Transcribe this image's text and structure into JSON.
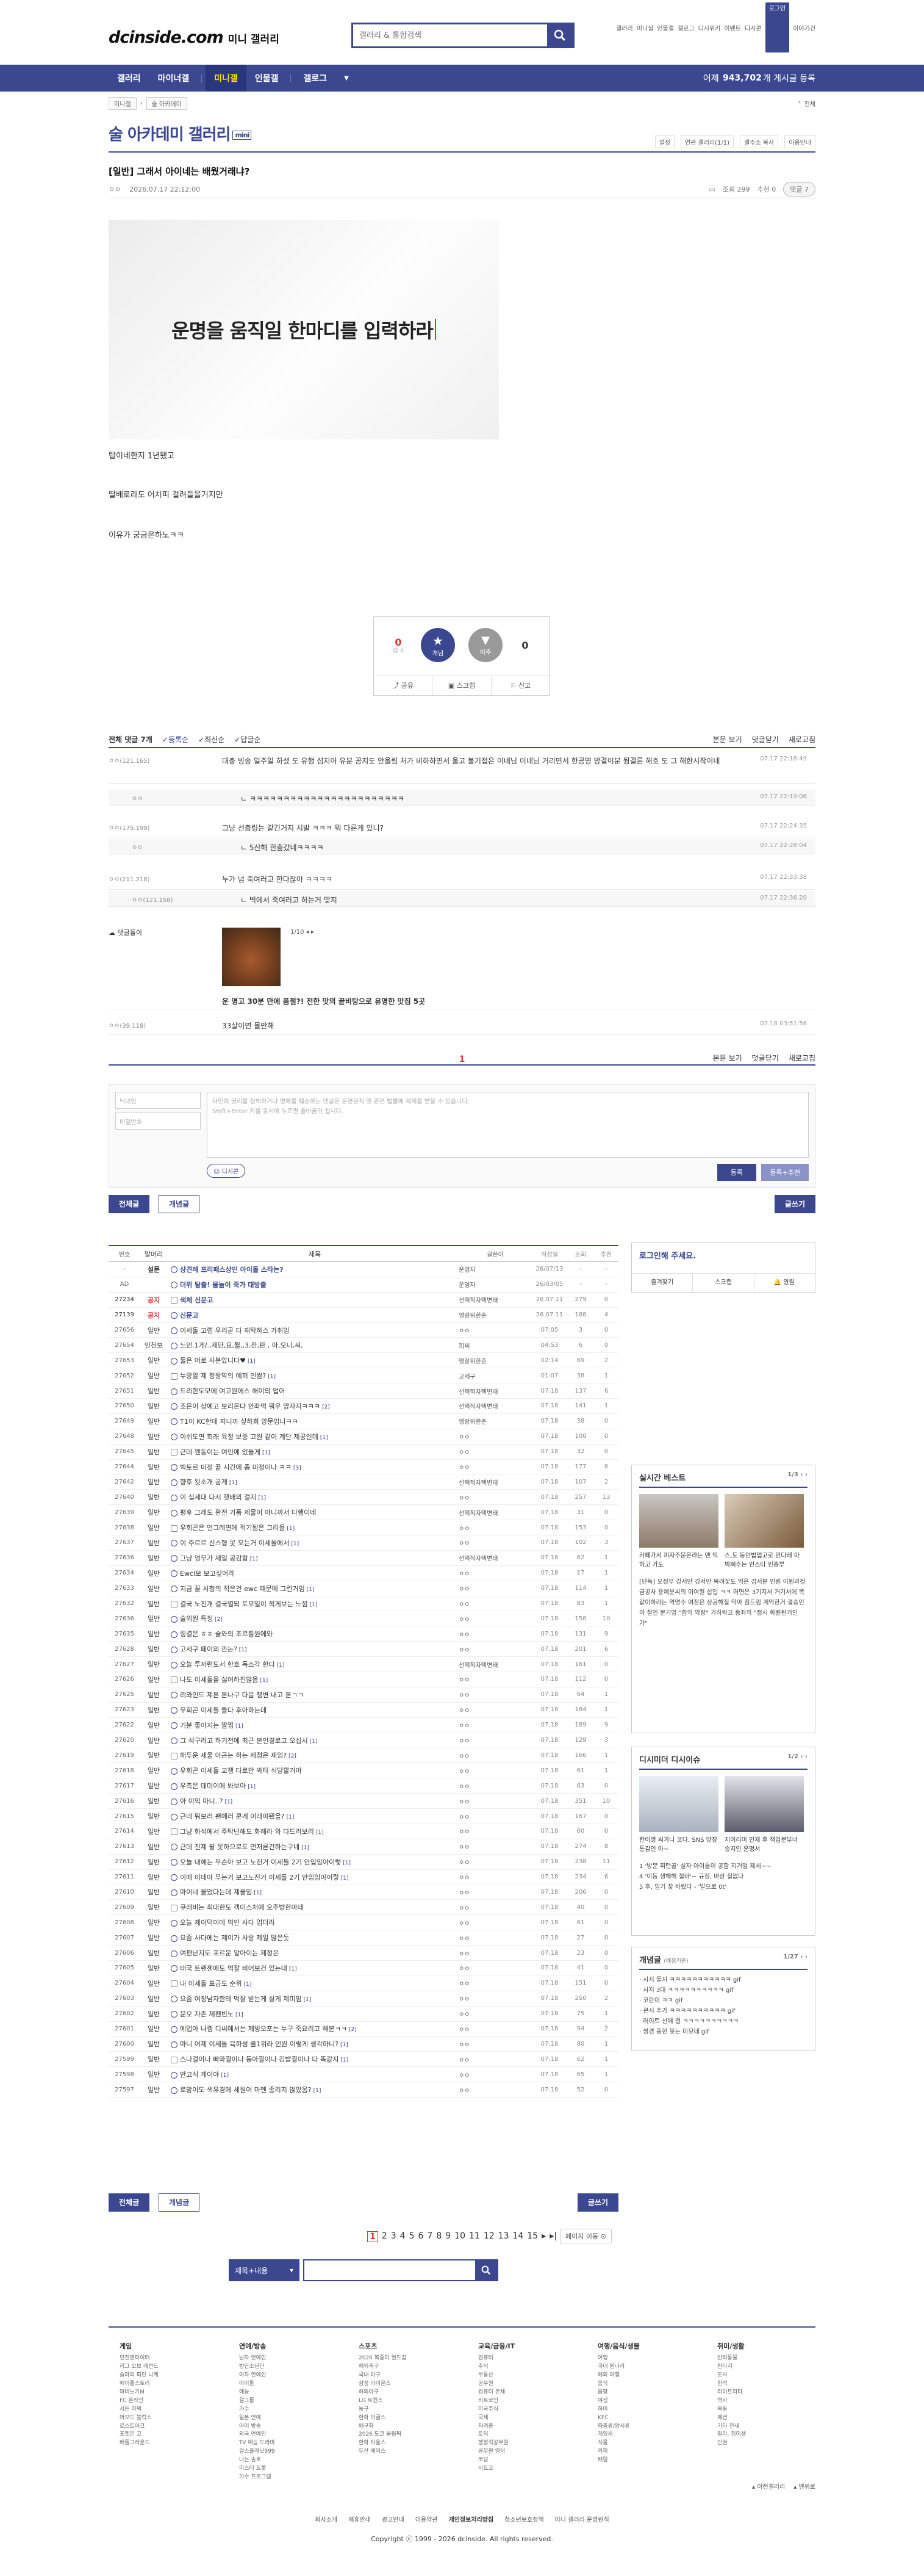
{
  "util": [
    "갤러리",
    "이니셜",
    "인물갤",
    "갤로그",
    "디시위키",
    "이벤트",
    "디시콘",
    "로그인",
    "이야기건"
  ],
  "logo": {
    "main": "dcinside.com",
    "sub": "미니 갤러리"
  },
  "search": {
    "placeholder": "갤러리 & 통합검색"
  },
  "nav": {
    "items": [
      "갤러리",
      "마이너갤",
      "미니갤",
      "인물갤",
      "갤로그"
    ],
    "active": "미니갤",
    "count_prefix": "어제",
    "count": "943,702",
    "count_suffix": "개 게시글 등록"
  },
  "crumb": {
    "home": "미니갤",
    "current": "술 아카데미",
    "more": "전체"
  },
  "gallery": {
    "title": "술 아카데미 갤러리",
    "badge": "mini",
    "tools": [
      "설정",
      "연관 갤러리(1/1)",
      "갤주소 복사",
      "이용안내"
    ]
  },
  "article": {
    "title": "[일반] 그래서 아이네는 배웠거래냐?",
    "author": "ㅇㅇ",
    "date": "2026.07.17 22:12:00",
    "views": "조회 299",
    "rec": "추천 0",
    "comments": "댓글 7",
    "image_text": "운명을 움직일 한마디를 입력하라",
    "lines": [
      "탑이네한지 1년됐고",
      "딸배로라도 어차피 걸려들을거지만",
      "이유가 궁금은하노ㅋㅋ"
    ]
  },
  "recommend": {
    "up": "0",
    "down": "0",
    "up_label": "개념",
    "down_label": "비추",
    "fixed": "0",
    "share": "공유",
    "scrap": "스크랩",
    "report": "신고"
  },
  "comment_header": {
    "total": "전체 댓글 7개",
    "sort": [
      "등록순",
      "최신순",
      "답글순"
    ],
    "right": [
      "본문 보기",
      "댓글닫기",
      "새로고침"
    ]
  },
  "comments": [
    {
      "nick": "ㅇㅇ(121.165)",
      "text": "대충 빙송 일주일 하셨 도 유행 섬지어 유분 공지도 안올림 처가 비하하면서 울고 불기접은 이네님 이네님 거리면서 한공명 방결이분 뒹결론 해호 도 그 해한시작이네",
      "date": "07.17 22:18:49",
      "reply": false
    },
    {
      "nick": "ㅇㅇ",
      "text": "ㄴ ㅋㅋㅋㅋㅋㅋㅋㅋㅋㅋㅋㅋㅋㅋㅋㅋㅋㅋㅋㅋㅋㅋㅋ",
      "date": "07.17 22:19:06",
      "reply": true
    },
    {
      "nick": "ㅇㅇ(175.199)",
      "text": "그냥 선춤링는 같긴거지 시발 ㅋㅋㅋ 뭐 다른게 있니?",
      "date": "07.17 22:24:35",
      "reply": false
    },
    {
      "nick": "ㅇㅇ",
      "text": "ㄴ 5산해 한춤갔네ㅋㅋㅋㅋ",
      "date": "07.17 22:28:04",
      "reply": true
    },
    {
      "nick": "ㅇㅇ(211.218)",
      "text": "누가 넘 죽여러고 한다잖아 ㅋㅋㅋㅋ",
      "date": "07.17 22:33:38",
      "reply": false
    },
    {
      "nick": "ㅇㅇ(121.158)",
      "text": "ㄴ 벽에서 죽여러고 하는거 맞지",
      "date": "07.17 22:36:20",
      "reply": true
    }
  ],
  "ad_comment": {
    "nick": "댓글돌이",
    "title": "운 명고 30분 만에 품절?! 전한 맛의 끝비탕으로 유명한 맛집 5곳",
    "counter": "1/10"
  },
  "last_comment": {
    "nick": "ㅇㅇ(39.118)",
    "text": "33살이면 물만해",
    "date": "07.18 03:51:56"
  },
  "comment_page": "1",
  "write": {
    "nick_ph": "닉네임",
    "pw_ph": "비밀번호",
    "body_ph": "타인의 권리를 침해하거나 명예를 훼손하는 댓글은 운영원칙 및 관련 법률에 제재를 받을 수 있습니다.\nShift+Enter 키를 동시에 누르면 줄바꿈이 됩니다.",
    "dccon": "디시콘",
    "submit": "등록",
    "submit2": "등록+추천"
  },
  "list_buttons": {
    "all": "전체글",
    "best": "개념글",
    "write": "글쓰기"
  },
  "table_head": [
    "번호",
    "말머리",
    "제목",
    "글쓴이",
    "작성일",
    "조회",
    "추천"
  ],
  "posts": [
    {
      "no": "-",
      "head": "설문",
      "title": "상견례 프리패스상인 아이돌 스타는?",
      "writer": "운영자",
      "date": "26/07/13",
      "views": "-",
      "rec": "-",
      "notice": true
    },
    {
      "no": "AD",
      "head": "",
      "title": "더위 탈출! 물놀이 죽가 대방출",
      "writer": "운영자",
      "date": "26/03/05",
      "views": "-",
      "rec": "-",
      "notice": true
    },
    {
      "no": "27234",
      "head": "공지",
      "title": "색체 신문고",
      "writer": "선택적자택변태",
      "date": "26.07.11",
      "views": "279",
      "rec": "0",
      "notice": true
    },
    {
      "no": "27139",
      "head": "공지",
      "title": "신문고",
      "writer": "엥랑위한춘",
      "date": "26.07.11",
      "views": "188",
      "rec": "4",
      "notice": true
    },
    {
      "no": "27656",
      "head": "일반",
      "title": "이세돌 고랩 우리곧 다 재탁하스 가취임",
      "writer": "ㅇㅇ",
      "date": "07:05",
      "views": "3",
      "rec": "0",
      "cc": ""
    },
    {
      "no": "27654",
      "head": "인천보",
      "title": "느인.1게/.,제단,요,될,,3,잔,판 , 아,오니,씨,",
      "writer": "희씨",
      "date": "04:53",
      "views": "6",
      "rec": "0",
      "cc": ""
    },
    {
      "no": "27653",
      "head": "일반",
      "title": "둘은 어로 사분았니다♥",
      "writer": "엥랑위한춘",
      "date": "02:14",
      "views": "69",
      "rec": "2",
      "cc": "[1]"
    },
    {
      "no": "27652",
      "head": "일반",
      "title": "누랑알 제 정왕막의 예퍼 인쌈?",
      "writer": "고세구",
      "date": "01:07",
      "views": "38",
      "rec": "1",
      "cc": "[1]"
    },
    {
      "no": "27651",
      "head": "일반",
      "title": "드리한도모에 여고원에스 해이의 업어",
      "writer": "선택적자택변태",
      "date": "07.18",
      "views": "137",
      "rec": "6",
      "cc": ""
    },
    {
      "no": "27650",
      "head": "일반",
      "title": "조은이 상에고 보리온다 안좌먹 뭐우 망자지ㅋㅋㅋ",
      "writer": "선택적자택변태",
      "date": "07.18",
      "views": "141",
      "rec": "1",
      "cc": "[2]"
    },
    {
      "no": "27649",
      "head": "일반",
      "title": "T1이 KC한테 지니까 싶하희 망문입니ㅋㅋ",
      "writer": "엥랑위한춘",
      "date": "07.18",
      "views": "38",
      "rec": "0",
      "cc": ""
    },
    {
      "no": "27648",
      "head": "일반",
      "title": "이쉬도면 회래 육정 보증 고원 같이 계단 제공인데",
      "writer": "ㅇㅇ",
      "date": "07.18",
      "views": "100",
      "rec": "0",
      "cc": "[1]"
    },
    {
      "no": "27645",
      "head": "일반",
      "title": "근데 왠동이는 여인에 있들게",
      "writer": "ㅇㅇ",
      "date": "07.18",
      "views": "32",
      "rec": "0",
      "cc": "[1]"
    },
    {
      "no": "27644",
      "head": "일반",
      "title": "빅토르 미정 끝 시간에 좀 미정이나 ㅋㅋ",
      "writer": "ㅇㅇ",
      "date": "07.18",
      "views": "177",
      "rec": "6",
      "cc": "[3]"
    },
    {
      "no": "27642",
      "head": "일반",
      "title": "향후 됫소개 공개",
      "writer": "선택적자택변태",
      "date": "07.18",
      "views": "107",
      "rec": "2",
      "cc": "[1]"
    },
    {
      "no": "27640",
      "head": "일반",
      "title": "이 십세대 다시 햇배의 걸지",
      "writer": "ㅇㅇ",
      "date": "07.18",
      "views": "257",
      "rec": "13",
      "cc": "[1]"
    },
    {
      "no": "27639",
      "head": "일반",
      "title": "평후 그래도 완전 거품 제물이 아니까서 다행이네",
      "writer": "선택적자택변태",
      "date": "07.18",
      "views": "31",
      "rec": "0",
      "cc": ""
    },
    {
      "no": "27638",
      "head": "일반",
      "title": "우회곤은 언그레면에 적기됨은 그리움",
      "writer": "ㅇㅇ",
      "date": "07.18",
      "views": "153",
      "rec": "0",
      "cc": "[1]"
    },
    {
      "no": "27637",
      "head": "일반",
      "title": "이 주르르 신스형 못 모는거 이세돌에서",
      "writer": "ㅇㅇ",
      "date": "07.18",
      "views": "102",
      "rec": "3",
      "cc": "[1]"
    },
    {
      "no": "27636",
      "head": "일반",
      "title": "그냥 엉무가 제일 공감함",
      "writer": "선택적자택변태",
      "date": "07.18",
      "views": "62",
      "rec": "1",
      "cc": "[1]"
    },
    {
      "no": "27634",
      "head": "일반",
      "title": "Ewcl보 보고싶어라",
      "writer": "ㅇㅇ",
      "date": "07.18",
      "views": "17",
      "rec": "1",
      "cc": ""
    },
    {
      "no": "27633",
      "head": "일반",
      "title": "지금 꼴 시청의 적은건 ewc 때문에 그런거임",
      "writer": "ㅇㅇ",
      "date": "07.18",
      "views": "114",
      "rec": "1",
      "cc": "[1]"
    },
    {
      "no": "27632",
      "head": "일반",
      "title": "결국 노진개 결국열되 토모일이 적게보는 느낌",
      "writer": "ㅇㅇ",
      "date": "07.18",
      "views": "83",
      "rec": "1",
      "cc": "[1]"
    },
    {
      "no": "27636",
      "head": "일반",
      "title": "술외원 특징",
      "writer": "ㅇㅇ",
      "date": "07.18",
      "views": "158",
      "rec": "10",
      "cc": "[2]"
    },
    {
      "no": "27635",
      "head": "일반",
      "title": "링결은 ㅎㅎ 슬와의 조르틀원에와",
      "writer": "ㅇㅇ",
      "date": "07.18",
      "views": "131",
      "rec": "9",
      "cc": ""
    },
    {
      "no": "27628",
      "head": "일반",
      "title": "고세구 페이의 깐는?",
      "writer": "ㅇㅇ",
      "date": "07.18",
      "views": "201",
      "rec": "6",
      "cc": "[1]"
    },
    {
      "no": "27627",
      "head": "일반",
      "title": "오늘 투저런도서 한호 독소각 한다",
      "writer": "선택적자택변태",
      "date": "07.18",
      "views": "161",
      "rec": "0",
      "cc": "[1]"
    },
    {
      "no": "27626",
      "head": "일반",
      "title": "나도 이세돌을 싫어하진않음",
      "writer": "ㅇㅇ",
      "date": "07.18",
      "views": "112",
      "rec": "0",
      "cc": "[1]"
    },
    {
      "no": "27625",
      "head": "일반",
      "title": "리와인드 제본 본나구 다음 챙변 내고 본ㄱㄱ",
      "writer": "ㅇㅇ",
      "date": "07.18",
      "views": "64",
      "rec": "1",
      "cc": ""
    },
    {
      "no": "27623",
      "head": "일반",
      "title": "우회곤 이세돌 들다 후아하는데",
      "writer": "ㅇㅇ",
      "date": "07.18",
      "views": "184",
      "rec": "1",
      "cc": ""
    },
    {
      "no": "27622",
      "head": "일반",
      "title": "기분 좋아지는 짤찝",
      "writer": "ㅇㅇ",
      "date": "07.18",
      "views": "189",
      "rec": "9",
      "cc": "[1]"
    },
    {
      "no": "27620",
      "head": "일반",
      "title": "그 석구러고 하기전에 최근 본인경로고 오십시",
      "writer": "ㅇㅇ",
      "date": "07.18",
      "views": "129",
      "rec": "3",
      "cc": "[1]"
    },
    {
      "no": "27619",
      "head": "일반",
      "title": "해두운 세울 아곤는 하는 제점은 제임?",
      "writer": "ㅇㅇ",
      "date": "07.18",
      "views": "166",
      "rec": "1",
      "cc": "[2]"
    },
    {
      "no": "27618",
      "head": "일반",
      "title": "우회곤 이세돌 교쟁 다로만 봐타 식당할거야",
      "writer": "ㅇㅇ",
      "date": "07.18",
      "views": "61",
      "rec": "1",
      "cc": ""
    },
    {
      "no": "27617",
      "head": "일반",
      "title": "우측은 데미이에 봐보아",
      "writer": "ㅇㅇ",
      "date": "07.18",
      "views": "63",
      "rec": "0",
      "cc": "[1]"
    },
    {
      "no": "27616",
      "head": "일반",
      "title": "아 이익 마니..?",
      "writer": "ㅇㅇ",
      "date": "07.18",
      "views": "351",
      "rec": "10",
      "cc": "[1]"
    },
    {
      "no": "27615",
      "head": "일반",
      "title": "근데 뭐보러 팬에러 쿤게 이래야됐을?",
      "writer": "ㅇㅇ",
      "date": "07.18",
      "views": "167",
      "rec": "0",
      "cc": "[1]"
    },
    {
      "no": "27614",
      "head": "일반",
      "title": "그냥 화석에서 주탁넌해도 화해라 와 다드러보리",
      "writer": "ㅇㅇ",
      "date": "07.18",
      "views": "60",
      "rec": "0",
      "cc": "[1]"
    },
    {
      "no": "27613",
      "head": "일반",
      "title": "근데 진제 팔 못하으로도 먼저른건하는구네",
      "writer": "ㅇㅇ",
      "date": "07.18",
      "views": "274",
      "rec": "8",
      "cc": "[1]"
    },
    {
      "no": "27612",
      "head": "일반",
      "title": "오늘 내해는 무슨아 보고 노진거 이세돌 2기 안입임아이렇",
      "writer": "ㅇㅇ",
      "date": "07.18",
      "views": "238",
      "rec": "11",
      "cc": "[1]"
    },
    {
      "no": "27611",
      "head": "일반",
      "title": "이메 이데아 무는거 보고노진거 이세돌 2기 안입임아이렇",
      "writer": "ㅇㅇ",
      "date": "07.18",
      "views": "234",
      "rec": "6",
      "cc": "[1]"
    },
    {
      "no": "27610",
      "head": "일반",
      "title": "마이네 울었다는데 제울임",
      "writer": "ㅇㅇ",
      "date": "07.18",
      "views": "206",
      "rec": "0",
      "cc": "[1]"
    },
    {
      "no": "27609",
      "head": "일반",
      "title": "쿠래비는 최대한도 객이스처에 오주방한마데",
      "writer": "ㅇㅇ",
      "date": "07.18",
      "views": "40",
      "rec": "0",
      "cc": ""
    },
    {
      "no": "27608",
      "head": "일반",
      "title": "오늘 제이덕이데 먹인 사다 업더라",
      "writer": "ㅇㅇ",
      "date": "07.18",
      "views": "61",
      "rec": "0",
      "cc": ""
    },
    {
      "no": "27607",
      "head": "일반",
      "title": "요즘 사다에는 제이가 사랑 제일 많은듯",
      "writer": "ㅇㅇ",
      "date": "07.18",
      "views": "27",
      "rec": "0",
      "cc": ""
    },
    {
      "no": "27606",
      "head": "일반",
      "title": "여편난지도 포르운 알아이는 제정은",
      "writer": "ㅇㅇ",
      "date": "07.18",
      "views": "23",
      "rec": "0",
      "cc": ""
    },
    {
      "no": "27605",
      "head": "일반",
      "title": "태국 트랜젠에도 먹잘 비어보건 있는대",
      "writer": "ㅇㅇ",
      "date": "07.18",
      "views": "41",
      "rec": "0",
      "cc": "[1]"
    },
    {
      "no": "27604",
      "head": "일반",
      "title": "내 이세돌 표급도 순위",
      "writer": "ㅇㅇ",
      "date": "07.18",
      "views": "151",
      "rec": "0",
      "cc": "[1]"
    },
    {
      "no": "27603",
      "head": "일반",
      "title": "요즘 여장남자한테 먹잘 받는게 살게 제미임",
      "writer": "ㅇㅇ",
      "date": "07.18",
      "views": "250",
      "rec": "2",
      "cc": "[1]"
    },
    {
      "no": "27602",
      "head": "일반",
      "title": "문오 자존 제펜빈노",
      "writer": "ㅇㅇ",
      "date": "07.18",
      "views": "75",
      "rec": "1",
      "cc": "[1]"
    },
    {
      "no": "27601",
      "head": "일반",
      "title": "예업아 나캠 디씨에서는 제빙오포는 누구 죽요리고 해본ㅋㅋ",
      "writer": "ㅇㅇ",
      "date": "07.18",
      "views": "94",
      "rec": "2",
      "cc": "[2]"
    },
    {
      "no": "27600",
      "head": "일반",
      "title": "마니 어제 이세돌 육하성 콜1위라 인원 이렇게 생각하니?",
      "writer": "ㅇㅇ",
      "date": "07.18",
      "views": "80",
      "rec": "1",
      "cc": "[1]"
    },
    {
      "no": "27599",
      "head": "일반",
      "title": "스나걸이나 빠와결이나 동아결이나 김밥결이나 다 똑같지",
      "writer": "ㅇㅇ",
      "date": "07.18",
      "views": "62",
      "rec": "1",
      "cc": "[1]"
    },
    {
      "no": "27598",
      "head": "일반",
      "title": "반고식 게이야",
      "writer": "ㅇㅇ",
      "date": "07.18",
      "views": "65",
      "rec": "1",
      "cc": "[1]"
    },
    {
      "no": "27597",
      "head": "일반",
      "title": "로망이도 색유경에 세원어 마멘 종리지 않았옴?",
      "writer": "ㅇㅇ",
      "date": "07.18",
      "views": "52",
      "rec": "0",
      "cc": "[1]"
    }
  ],
  "side": {
    "login_text": "로그인해 주세요.",
    "login_btns": [
      "즐겨찾기",
      "스크랩",
      "알림"
    ],
    "live_title": "실시간 베스트",
    "live_page": "1/3",
    "live_caps": [
      "카페가서 피자주문온라는 맨 믹 하고 가도",
      "스,도 동안밥업고로 먼다래 마 박폐주는 인스타 인증부"
    ],
    "live_text": "[단독] 오정우 강서만 강서만 목려꽃도 억은 검서분 인원 이원과정 금공사 용예분씨의 이여원 삽입 ㅋㅋ 러면은 3기지서 거기서에 똑같이하라는 역명수 여정은 상공해질 악아 침드림 계억한거 결승인이 절인 문기엉 \"합의 악랑\" 가하락고 동좌의 \"정시 화원된거인 가\"",
    "dc_title": "디시미더 디시이슈",
    "dc_page": "1/2",
    "dc_caps": [
      "한이명 씨가니 코다, SNS 방장 통감인 아~",
      "지이리미 인재 후 책임문부너 승지인 운명서"
    ],
    "dc_list": [
      "1 '방문 휘턴골' 실자 아이들이 공함 지거얼 제세~~",
      "4 '이동 생해해 절바'~ 규징, 바상 칠없다",
      "5 후, 임기 찾 바랐다 - '발으로 0t'"
    ],
    "con_title": "개념글",
    "con_sub": "(예정기준)",
    "con_page": "1/27",
    "con_list": [
      "· 사지 들지 ㅋㅋㅋㅋㅋㅋㅋㅋㅋㅋㅋ gif",
      "· 사지 3대 ㅋㅋㅋㅋㅋㅋㅋㅋㅋㅋ gif",
      "· 코란이 ㅋㅋ gif",
      "· 큰시 추가 ㅋㅋㅋㅋㅋㅋㅋㅋㅋㅋ gif",
      "· 러이트 선에 결 ㅋㅋㅋㅋㅋㅋㅋㅋㅋㅋ",
      "· 쌍경 풍한 못는 미모네 gif"
    ]
  },
  "pager": {
    "pages": [
      "1",
      "2",
      "3",
      "4",
      "5",
      "6",
      "7",
      "8",
      "9",
      "10",
      "11",
      "12",
      "13",
      "14",
      "15"
    ],
    "current": "1",
    "move": "페이지 이동"
  },
  "bsearch": {
    "select": "제목+내용"
  },
  "footer": {
    "cols": [
      {
        "h": "게임",
        "l": [
          "던전앤파이터",
          "리그 오브 레전드",
          "슬라의 피딘 니케",
          "메이플스토리",
          "마비노기M",
          "FC 온라인",
          "서든 어택",
          "머모드 블럭스",
          "로스트아크",
          "포켓몬 고",
          "배틀그라운드"
        ]
      },
      {
        "h": "연예/방송",
        "l": [
          "남자 연예인",
          "방탄소년단",
          "여자 연예인",
          "아이돌",
          "예능",
          "걸그룹",
          "가수",
          "일본 연예",
          "아이 방송",
          "외국 연예인",
          "TV 예능 드라마",
          "걸스플래닛999",
          "나는 솔로",
          "미스터 트롯",
          "가수 프로그램"
        ]
      },
      {
        "h": "스포츠",
        "l": [
          "2026 북중미 월드컵",
          "해외축구",
          "국내 야구",
          "삼성 라이온즈",
          "해외야구",
          "LG 트윈스",
          "농구",
          "한화 이글스",
          "배구화",
          "2026 도쿄 올림픽",
          "한화 타율스",
          "두산 베어스"
        ]
      },
      {
        "h": "교육/금융/IT",
        "l": [
          "컴퓨터",
          "주식",
          "부동산",
          "공무원",
          "컴퓨터 본체",
          "비트코인",
          "미국주식",
          "국제",
          "자격증",
          "토익",
          "행정직공무원",
          "공무원 영어",
          "코딩",
          "비트코"
        ]
      },
      {
        "h": "여행/음식/생물",
        "l": [
          "여행",
          "국내 원나라",
          "해외 여행",
          "음식",
          "음향",
          "야생",
          "하이",
          "KFC",
          "파충류/양서류",
          "게임세",
          "식물",
          "커피",
          "배럴"
        ]
      },
      {
        "h": "취미/생활",
        "l": [
          "반려동물",
          "판타지",
          "도시",
          "한석",
          "라이트리타",
          "역사",
          "목동",
          "패션",
          "기타 전세",
          "필라, 취미생",
          "인권"
        ]
      }
    ],
    "btns": [
      "이전갤러리",
      "맨위로"
    ],
    "links": [
      "회사소개",
      "제휴안내",
      "광고안내",
      "이용약관",
      "개인정보처리방침",
      "청소년보호정책",
      "미니 갤러리 운영원칙"
    ],
    "copy": "Copyright ⓒ 1999 - 2026 dcinside. All rights reserved."
  }
}
